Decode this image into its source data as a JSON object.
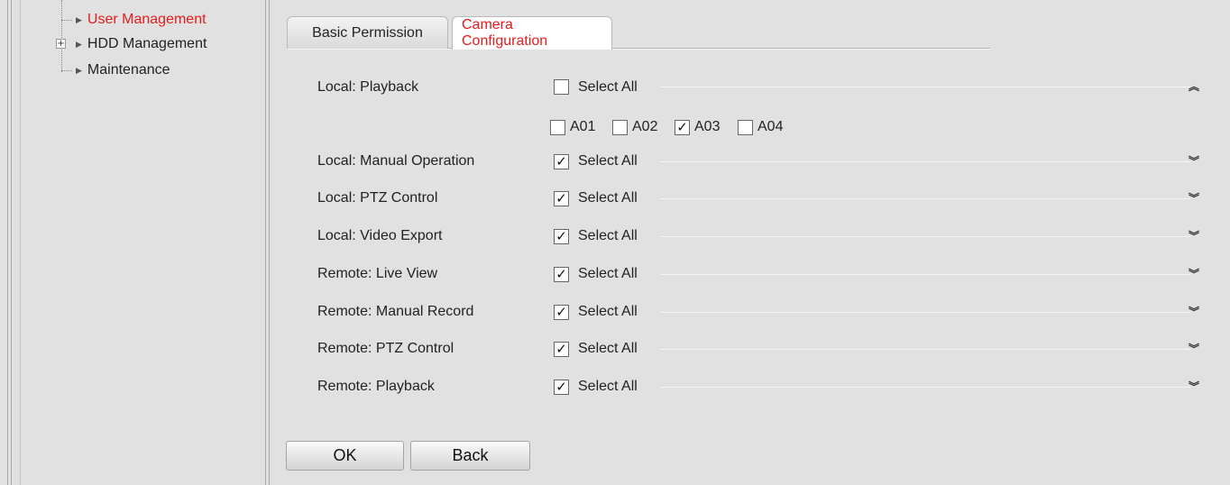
{
  "sidebar": {
    "items": [
      {
        "label": "User Management",
        "active": true
      },
      {
        "label": "HDD Management",
        "active": false,
        "expander": "+"
      },
      {
        "label": "Maintenance",
        "active": false
      }
    ]
  },
  "tabs": [
    {
      "label": "Basic Permission",
      "active": false
    },
    {
      "label": "Camera Configuration",
      "active": true
    }
  ],
  "permissions": [
    {
      "label": "Local: Playback",
      "select_all": "Select All",
      "select_all_checked": false,
      "expanded": true,
      "channels": [
        {
          "label": "A01",
          "checked": false
        },
        {
          "label": "A02",
          "checked": false
        },
        {
          "label": "A03",
          "checked": true
        },
        {
          "label": "A04",
          "checked": false
        }
      ]
    },
    {
      "label": "Local: Manual Operation",
      "select_all": "Select All",
      "select_all_checked": true,
      "expanded": false
    },
    {
      "label": "Local: PTZ Control",
      "select_all": "Select All",
      "select_all_checked": true,
      "expanded": false
    },
    {
      "label": "Local: Video Export",
      "select_all": "Select All",
      "select_all_checked": true,
      "expanded": false
    },
    {
      "label": "Remote: Live View",
      "select_all": "Select All",
      "select_all_checked": true,
      "expanded": false
    },
    {
      "label": "Remote: Manual Record",
      "select_all": "Select All",
      "select_all_checked": true,
      "expanded": false
    },
    {
      "label": "Remote: PTZ Control",
      "select_all": "Select All",
      "select_all_checked": true,
      "expanded": false
    },
    {
      "label": "Remote: Playback",
      "select_all": "Select All",
      "select_all_checked": true,
      "expanded": false
    }
  ],
  "buttons": {
    "ok": "OK",
    "back": "Back"
  },
  "icons": {
    "check": "✓",
    "collapse": "︽",
    "expand": "︾",
    "expander": "+"
  },
  "colors": {
    "active_text": "#e31d1d",
    "background": "#e1e1e1"
  }
}
